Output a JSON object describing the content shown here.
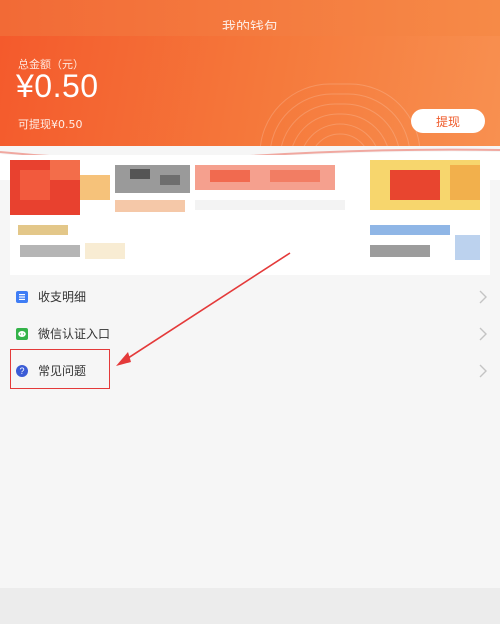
{
  "title_strip": {
    "title": "我的钱包"
  },
  "balance": {
    "total_label": "总金额（元）",
    "total_amount": "¥0.50",
    "available_label": "可提现¥0.50",
    "withdraw_label": "提现"
  },
  "menu": {
    "items": [
      {
        "label": "收支明细",
        "icon": "list-icon",
        "icon_color": "#3f7df5"
      },
      {
        "label": "微信认证入口",
        "icon": "wechat-icon",
        "icon_color": "#34b34a"
      },
      {
        "label": "常见问题",
        "icon": "question-icon",
        "icon_color": "#3b5cd6"
      }
    ]
  },
  "colors": {
    "header_start": "#f45a2c",
    "header_end": "#f89050",
    "accent": "#ef5a2a",
    "annotation_red": "#e43a3a"
  }
}
